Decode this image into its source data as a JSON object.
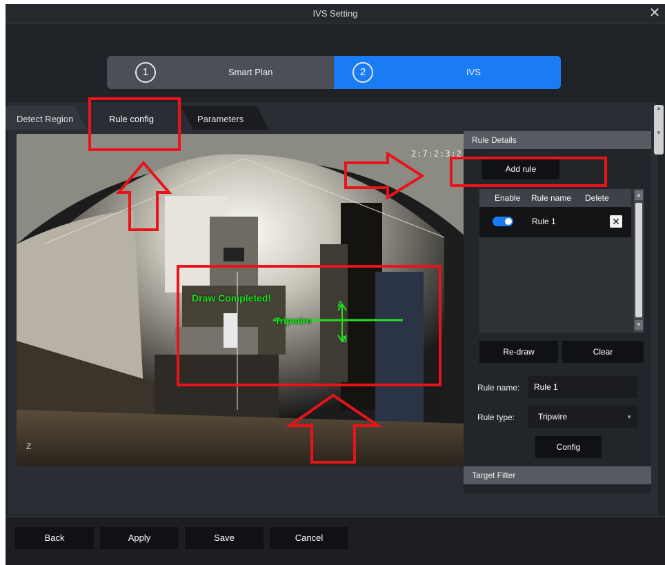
{
  "window": {
    "title": "IVS Setting",
    "close_glyph": "✕"
  },
  "stepper": {
    "steps": [
      {
        "number": "1",
        "label": "Smart Plan"
      },
      {
        "number": "2",
        "label": "IVS"
      }
    ],
    "active_color": "#1a7cf5"
  },
  "tabs": [
    {
      "label": "Detect Region"
    },
    {
      "label": "Rule config"
    },
    {
      "label": "Parameters"
    }
  ],
  "video": {
    "osd_time": "2:7:2:3:2",
    "osd_corner": "Z",
    "overlay_status": "Draw Completed!",
    "rule_label": "Tripwire",
    "direction_a": "A",
    "direction_b": "B",
    "line_color": "#21e01f"
  },
  "rule_details": {
    "header": "Rule Details",
    "add_rule_label": "Add rule",
    "table": {
      "columns": [
        "Enable",
        "Rule name",
        "Delete"
      ],
      "rows": [
        {
          "enabled": true,
          "name": "Rule 1",
          "delete_glyph": "✕"
        }
      ]
    },
    "redraw_label": "Re-draw",
    "clear_label": "Clear",
    "rule_name_label": "Rule name:",
    "rule_name_value": "Rule 1",
    "rule_type_label": "Rule type:",
    "rule_type_value": "Tripwire",
    "config_label": "Config"
  },
  "target_filter": {
    "header": "Target Filter"
  },
  "footer": {
    "back": "Back",
    "apply": "Apply",
    "save": "Save",
    "cancel": "Cancel"
  },
  "annotation_color": "#e8141a"
}
